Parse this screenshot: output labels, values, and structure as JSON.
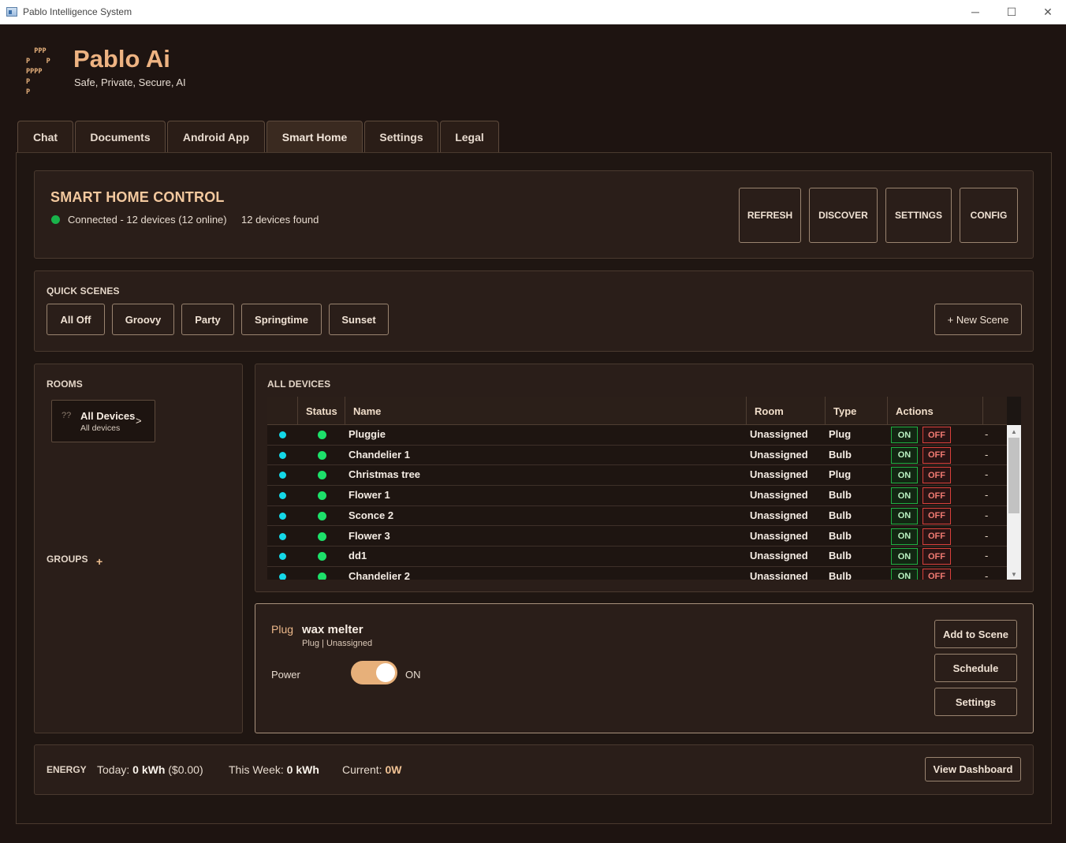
{
  "window": {
    "title": "Pablo Intelligence System",
    "minimize": "─",
    "maximize": "☐",
    "close": "✕"
  },
  "brand": {
    "logo_lines": [
      "  PPP",
      "P    P",
      "PPPP",
      "P",
      "P"
    ],
    "title": "Pablo Ai",
    "subtitle": "Safe, Private, Secure, AI"
  },
  "tabs": [
    {
      "label": "Chat"
    },
    {
      "label": "Documents"
    },
    {
      "label": "Android App"
    },
    {
      "label": "Smart Home"
    },
    {
      "label": "Settings"
    },
    {
      "label": "Legal"
    }
  ],
  "smart_home": {
    "title": "SMART HOME CONTROL",
    "status": "Connected - 12 devices (12 online)",
    "found": "12 devices found",
    "buttons": {
      "refresh": "REFRESH",
      "discover": "DISCOVER",
      "settings": "SETTINGS",
      "config": "CONFIG"
    },
    "status_color": "#19b34b"
  },
  "scenes": {
    "label": "QUICK SCENES",
    "items": [
      "All Off",
      "Groovy",
      "Party",
      "Springtime",
      "Sunset"
    ],
    "new_scene": "+ New Scene"
  },
  "rooms": {
    "label": "ROOMS",
    "items": [
      {
        "icon": "??",
        "name": "All Devices",
        "desc": "All devices",
        "chevron": ">"
      }
    ],
    "groups_label": "GROUPS",
    "groups_add": "+"
  },
  "devices": {
    "label": "ALL DEVICES",
    "columns": [
      "Status",
      "Name",
      "Room",
      "Type",
      "Actions"
    ],
    "on_label": "ON",
    "off_label": "OFF",
    "rows": [
      {
        "name": "Pluggie",
        "room": "Unassigned",
        "type": "Plug",
        "extra": "-"
      },
      {
        "name": "Chandelier 1",
        "room": "Unassigned",
        "type": "Bulb",
        "extra": "-"
      },
      {
        "name": "Christmas tree",
        "room": "Unassigned",
        "type": "Plug",
        "extra": "-"
      },
      {
        "name": "Flower 1",
        "room": "Unassigned",
        "type": "Bulb",
        "extra": "-"
      },
      {
        "name": "Sconce 2",
        "room": "Unassigned",
        "type": "Bulb",
        "extra": "-"
      },
      {
        "name": "Flower 3",
        "room": "Unassigned",
        "type": "Bulb",
        "extra": "-"
      },
      {
        "name": "dd1",
        "room": "Unassigned",
        "type": "Bulb",
        "extra": "-"
      },
      {
        "name": "Chandelier 2",
        "room": "Unassigned",
        "type": "Bulb",
        "extra": "-"
      }
    ],
    "online_color": "#1de06a",
    "connected_color": "#14d8e8"
  },
  "detail": {
    "type": "Plug",
    "name": "wax melter",
    "sub": "Plug | Unassigned",
    "power_label": "Power",
    "power_state": "ON",
    "power_on": true,
    "buttons": {
      "add_to_scene": "Add to Scene",
      "schedule": "Schedule",
      "settings": "Settings"
    }
  },
  "energy": {
    "label": "ENERGY",
    "today_label": "Today:",
    "today_value": "0 kWh",
    "today_cost": "($0.00)",
    "week_label": "This Week:",
    "week_value": "0 kWh",
    "current_label": "Current:",
    "current_value": "0W",
    "dashboard": "View Dashboard"
  }
}
